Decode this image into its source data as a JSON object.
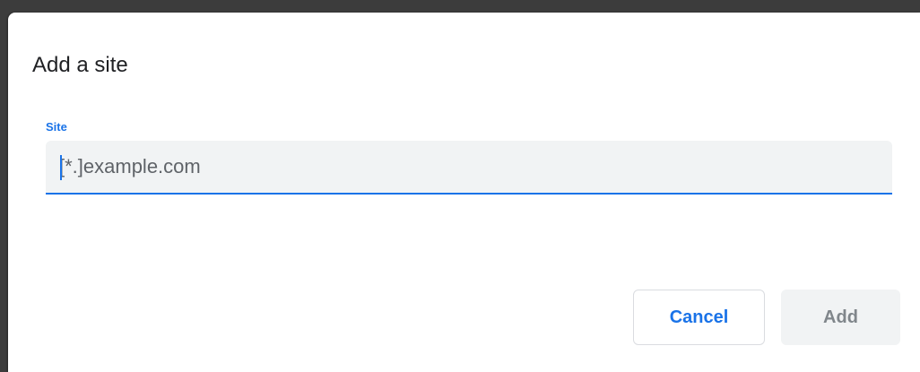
{
  "dialog": {
    "title": "Add a site",
    "site_field": {
      "label": "Site",
      "placeholder": "[*.]example.com",
      "value": ""
    },
    "buttons": {
      "cancel_label": "Cancel",
      "add_label": "Add",
      "add_enabled": false
    }
  },
  "colors": {
    "accent": "#1a73e8",
    "title_text": "#202124",
    "input_background": "#f1f3f4",
    "disabled_button_text": "#80868b"
  }
}
